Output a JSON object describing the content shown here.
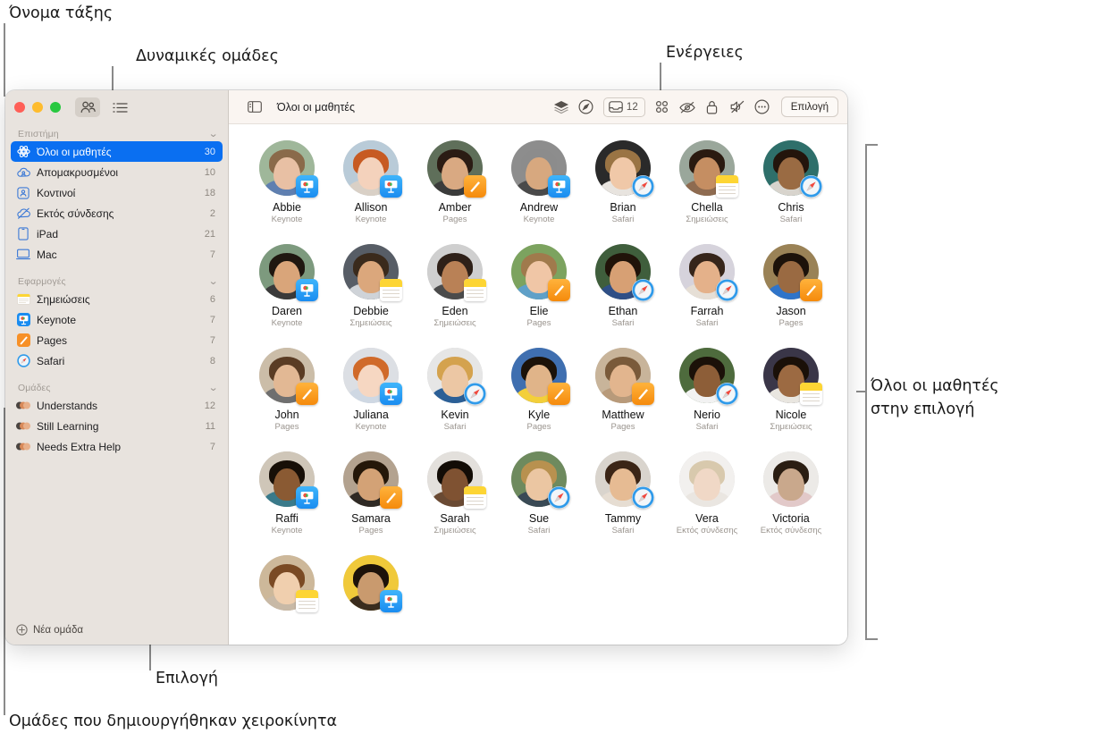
{
  "annotations": {
    "class_name": "Όνομα τάξης",
    "dynamic_groups": "Δυναμικές ομάδες",
    "actions": "Ενέργειες",
    "all_students_in_selection_line1": "Όλοι οι μαθητές",
    "all_students_in_selection_line2": "στην επιλογή",
    "selection": "Επιλογή",
    "manual_groups": "Ομάδες που δημιουργήθηκαν χειροκίνητα"
  },
  "window": {
    "traffic_lights": [
      "close",
      "minimize",
      "zoom"
    ],
    "view_people_icon": "people-icon",
    "view_list_icon": "list-icon"
  },
  "toolbar": {
    "sidebar_toggle_icon": "sidebar-toggle-icon",
    "title": "Όλοι οι μαθητές",
    "actions": [
      {
        "name": "layers-icon",
        "label": ""
      },
      {
        "name": "navigate-icon",
        "label": ""
      },
      {
        "name": "inbox-icon",
        "label": "12"
      },
      {
        "name": "apps-grid-icon",
        "label": ""
      },
      {
        "name": "hide-screen-icon",
        "label": ""
      },
      {
        "name": "lock-icon",
        "label": ""
      },
      {
        "name": "mute-icon",
        "label": ""
      },
      {
        "name": "more-icon",
        "label": ""
      }
    ],
    "select_label": "Επιλογή"
  },
  "sidebar": {
    "sections": [
      {
        "title": "Επιστήμη",
        "items": [
          {
            "label": "Όλοι οι μαθητές",
            "count": "30",
            "icon": "class-icon",
            "selected": true
          },
          {
            "label": "Απομακρυσμένοι",
            "count": "10",
            "icon": "cloud-person-icon",
            "selected": false
          },
          {
            "label": "Κοντινοί",
            "count": "18",
            "icon": "nearby-person-icon",
            "selected": false
          },
          {
            "label": "Εκτός σύνδεσης",
            "count": "2",
            "icon": "cloud-slash-icon",
            "selected": false
          },
          {
            "label": "iPad",
            "count": "21",
            "icon": "ipad-icon",
            "selected": false
          },
          {
            "label": "Mac",
            "count": "7",
            "icon": "mac-icon",
            "selected": false
          }
        ]
      },
      {
        "title": "Εφαρμογές",
        "items": [
          {
            "label": "Σημειώσεις",
            "count": "6",
            "icon": "notes-app-icon",
            "selected": false
          },
          {
            "label": "Keynote",
            "count": "7",
            "icon": "keynote-app-icon",
            "selected": false
          },
          {
            "label": "Pages",
            "count": "7",
            "icon": "pages-app-icon",
            "selected": false
          },
          {
            "label": "Safari",
            "count": "8",
            "icon": "safari-app-icon",
            "selected": false
          }
        ]
      },
      {
        "title": "Ομάδες",
        "items": [
          {
            "label": "Understands",
            "count": "12",
            "icon": "group-avatars-icon",
            "selected": false
          },
          {
            "label": "Still Learning",
            "count": "11",
            "icon": "group-avatars-icon",
            "selected": false
          },
          {
            "label": "Needs Extra Help",
            "count": "7",
            "icon": "group-avatars-icon",
            "selected": false
          }
        ]
      }
    ],
    "new_group_label": "Νέα ομάδα",
    "new_group_icon": "plus-circle-icon",
    "selected_color": "#0a6ff1"
  },
  "students": [
    {
      "name": "Abbie",
      "app": "Keynote",
      "badge": "keynote",
      "skin": "#e8c0a4",
      "hair": "#8a6a4a",
      "bg": "#9fb79a",
      "shirt": "#5f7fb0"
    },
    {
      "name": "Allison",
      "app": "Keynote",
      "badge": "keynote",
      "skin": "#f4d2bc",
      "hair": "#c75a22",
      "bg": "#b9cbd8",
      "shirt": "#d9d0c6"
    },
    {
      "name": "Amber",
      "app": "Pages",
      "badge": "pages",
      "skin": "#d9a982",
      "hair": "#2b1c14",
      "bg": "#5f6f5a",
      "shirt": "#3b3b3b"
    },
    {
      "name": "Andrew",
      "app": "Keynote",
      "badge": "keynote",
      "skin": "#d7a87f",
      "hair": "#8c8c8c",
      "bg": "#8d8d8d",
      "shirt": "#4a4a4a"
    },
    {
      "name": "Brian",
      "app": "Safari",
      "badge": "safari",
      "skin": "#f0c8a8",
      "hair": "#9a7444",
      "bg": "#2a2a2a",
      "shirt": "#e8e4df"
    },
    {
      "name": "Chella",
      "app": "Σημειώσεις",
      "badge": "notes",
      "skin": "#c58e62",
      "hair": "#2a1a10",
      "bg": "#9aa79b",
      "shirt": "#8e6b50"
    },
    {
      "name": "Chris",
      "app": "Safari",
      "badge": "safari",
      "skin": "#9a6b43",
      "hair": "#23150c",
      "bg": "#2e6f6a",
      "shirt": "#d8d4cd"
    },
    {
      "name": "Daren",
      "app": "Keynote",
      "badge": "keynote",
      "skin": "#d9a57a",
      "hair": "#1f1710",
      "bg": "#7d9a7e",
      "shirt": "#3a3a3a"
    },
    {
      "name": "Debbie",
      "app": "Σημειώσεις",
      "badge": "notes",
      "skin": "#dba77c",
      "hair": "#3a2a1c",
      "bg": "#575d66",
      "shirt": "#cfd3d8"
    },
    {
      "name": "Eden",
      "app": "Σημειώσεις",
      "badge": "notes",
      "skin": "#b98156",
      "hair": "#2e2018",
      "bg": "#cfcfcf",
      "shirt": "#4b4b4b"
    },
    {
      "name": "Elie",
      "app": "Pages",
      "badge": "pages",
      "skin": "#f0c6a6",
      "hair": "#a07a4c",
      "bg": "#7ca35f",
      "shirt": "#5fa0c8"
    },
    {
      "name": "Ethan",
      "app": "Safari",
      "badge": "safari",
      "skin": "#d7a074",
      "hair": "#201309",
      "bg": "#3f5e3c",
      "shirt": "#2f4f86"
    },
    {
      "name": "Farrah",
      "app": "Safari",
      "badge": "safari",
      "skin": "#e4b18a",
      "hair": "#36251a",
      "bg": "#d6d3dc",
      "shirt": "#e6dfd6"
    },
    {
      "name": "Jason",
      "app": "Pages",
      "badge": "pages",
      "skin": "#9a6a42",
      "hair": "#1c120a",
      "bg": "#9a8256",
      "shirt": "#2f74c9"
    },
    {
      "name": "John",
      "app": "Pages",
      "badge": "pages",
      "skin": "#e2b894",
      "hair": "#5a3c24",
      "bg": "#cbbda8",
      "shirt": "#6f6f6f"
    },
    {
      "name": "Juliana",
      "app": "Keynote",
      "badge": "keynote",
      "skin": "#f6d7c2",
      "hair": "#d06a2a",
      "bg": "#dcdfe4",
      "shirt": "#cfd8e3"
    },
    {
      "name": "Kevin",
      "app": "Safari",
      "badge": "safari",
      "skin": "#ecc7a4",
      "hair": "#d4a24e",
      "bg": "#e6e6e6",
      "shirt": "#2b5f96"
    },
    {
      "name": "Kyle",
      "app": "Pages",
      "badge": "pages",
      "skin": "#e0b489",
      "hair": "#1b1209",
      "bg": "#3f6fb0",
      "shirt": "#f3cf3a"
    },
    {
      "name": "Matthew",
      "app": "Pages",
      "badge": "pages",
      "skin": "#e2b58e",
      "hair": "#7a5a3a",
      "bg": "#c8b49a",
      "shirt": "#b89a7a"
    },
    {
      "name": "Nerio",
      "app": "Safari",
      "badge": "safari",
      "skin": "#8d5e38",
      "hair": "#1b1109",
      "bg": "#4e6b3d",
      "shirt": "#f2f2f2"
    },
    {
      "name": "Nicole",
      "app": "Σημειώσεις",
      "badge": "notes",
      "skin": "#9c6a42",
      "hair": "#1a1008",
      "bg": "#3a3648",
      "shirt": "#e9e6e0"
    },
    {
      "name": "Raffi",
      "app": "Keynote",
      "badge": "keynote",
      "skin": "#8a5a33",
      "hair": "#170f07",
      "bg": "#cfc6b8",
      "shirt": "#3a7a8a"
    },
    {
      "name": "Samara",
      "app": "Pages",
      "badge": "pages",
      "skin": "#d3a276",
      "hair": "#241709",
      "bg": "#b3a28f",
      "shirt": "#2f2a25"
    },
    {
      "name": "Sarah",
      "app": "Σημειώσεις",
      "badge": "notes",
      "skin": "#7f5232",
      "hair": "#120c06",
      "bg": "#e3e0dc",
      "shirt": "#6a4a33"
    },
    {
      "name": "Sue",
      "app": "Safari",
      "badge": "safari",
      "skin": "#ebc6a2",
      "hair": "#b8914f",
      "bg": "#6e8a5e",
      "shirt": "#3a4a55"
    },
    {
      "name": "Tammy",
      "app": "Safari",
      "badge": "safari",
      "skin": "#e6bb93",
      "hair": "#3b2516",
      "bg": "#d9d4cd",
      "shirt": "#e6ddd2"
    },
    {
      "name": "Vera",
      "app": "Εκτός σύνδεσης",
      "badge": "none",
      "skin": "#f0d8c6",
      "hair": "#d8c9ad",
      "bg": "#f2f0ee",
      "shirt": "#eae6e1"
    },
    {
      "name": "Victoria",
      "app": "Εκτός σύνδεσης",
      "badge": "none",
      "skin": "#c9a88c",
      "hair": "#2a1d12",
      "bg": "#eceae7",
      "shirt": "#e2c9c9"
    },
    {
      "name": "",
      "app": "",
      "badge": "notes",
      "skin": "#f0cfae",
      "hair": "#7a4a24",
      "bg": "#cdb89a",
      "shirt": "#c8b9a6"
    },
    {
      "name": "",
      "app": "",
      "badge": "keynote",
      "skin": "#c99a6e",
      "hair": "#1d120a",
      "bg": "#f0c93a",
      "shirt": "#3a2c1e"
    }
  ]
}
